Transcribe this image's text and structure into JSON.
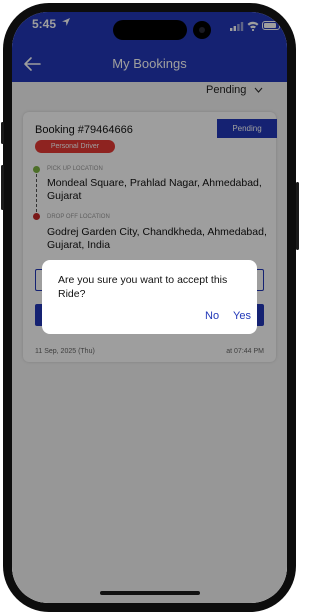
{
  "status_bar": {
    "time": "5:45"
  },
  "header": {
    "title": "My Bookings"
  },
  "filter": {
    "selected": "Pending"
  },
  "booking": {
    "number": "Booking #79464666",
    "status": "Pending",
    "tag": "Personal Driver",
    "pickup_label": "PICK UP LOCATION",
    "pickup_address": "Mondeal Square, Prahlad Nagar, Ahmedabad, Gujarat",
    "drop_label": "DROP OFF LOCATION",
    "drop_address": "Godrej Garden City, Chandkheda, Ahmedabad, Gujarat, India",
    "date": "11 Sep, 2025 (Thu)",
    "time": "at 07:44 PM"
  },
  "dialog": {
    "message": "Are you sure you want to accept this Ride?",
    "no_label": "No",
    "yes_label": "Yes"
  },
  "colors": {
    "primary": "#2238b8",
    "tag_red": "#e53935",
    "pickup_dot": "#7cb342",
    "drop_dot": "#c62828"
  }
}
